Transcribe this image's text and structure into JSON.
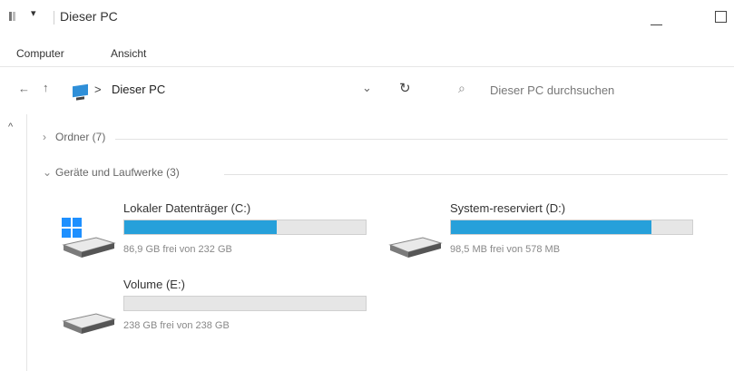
{
  "window": {
    "title": "Dieser PC"
  },
  "ribbon": {
    "tabs": [
      "Computer",
      "Ansicht"
    ]
  },
  "address": {
    "back_glyph": "←",
    "up_glyph": "↑",
    "crumb_sep": ">",
    "crumb": "Dieser PC",
    "refresh_glyph": "↻",
    "search_placeholder": "Dieser PC durchsuchen"
  },
  "groups": {
    "folders": {
      "label": "Ordner (7)",
      "expanded": false
    },
    "devices": {
      "label": "Geräte und Laufwerke (3)",
      "expanded": true
    }
  },
  "drives": [
    {
      "name": "Lokaler Datenträger (C:)",
      "free_text": "86,9 GB frei von 232 GB",
      "used_fraction": 0.63,
      "icon": "windows-drive-icon"
    },
    {
      "name": "System-reserviert (D:)",
      "free_text": "98,5 MB frei von 578 MB",
      "used_fraction": 0.83,
      "icon": "drive-icon"
    },
    {
      "name": "Volume (E:)",
      "free_text": "238 GB frei von 238 GB",
      "used_fraction": 0.0,
      "icon": "drive-icon"
    }
  ],
  "colors": {
    "bar_fill": "#26a0da",
    "bar_bg": "#e6e6e6",
    "windows_logo": "#1e90ff"
  }
}
